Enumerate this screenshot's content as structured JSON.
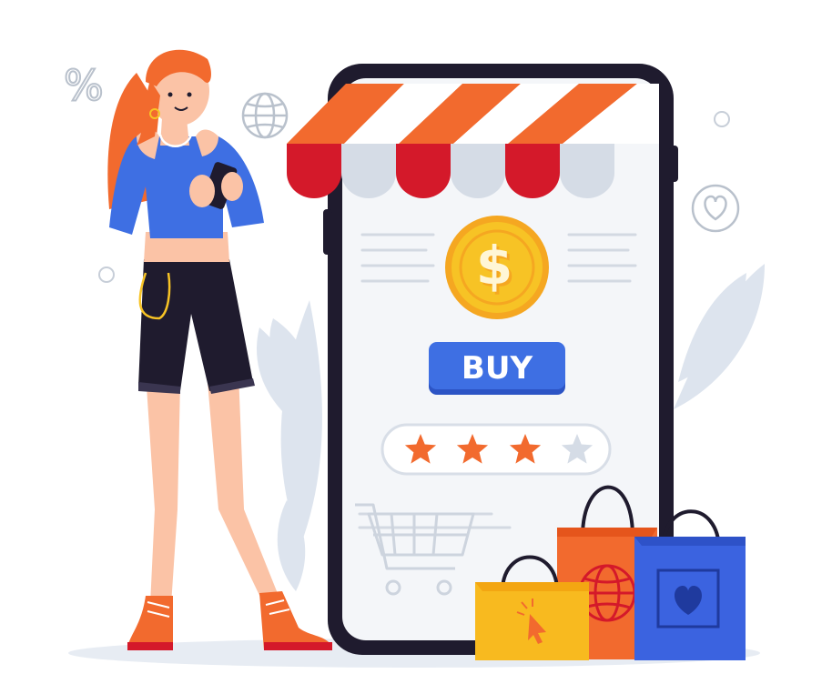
{
  "buy_button": {
    "label": "BUY"
  },
  "rating": {
    "stars_filled": 3,
    "stars_total": 4
  },
  "deco": {
    "percent_symbol": "%"
  },
  "colors": {
    "accent_orange": "#F26A2E",
    "awning_red": "#D4192A",
    "buy_blue": "#3E6FE3",
    "coin_gold": "#F7C325",
    "bag_yellow": "#F8BA1F",
    "bag_blue": "#3B63E0",
    "phone_frame": "#1F1B2E"
  },
  "icons": [
    "percent-icon",
    "globe-icon",
    "heart-icon",
    "dollar-coin-icon",
    "shopping-cart-icon",
    "cursor-icon",
    "globe-icon",
    "heart-icon"
  ]
}
